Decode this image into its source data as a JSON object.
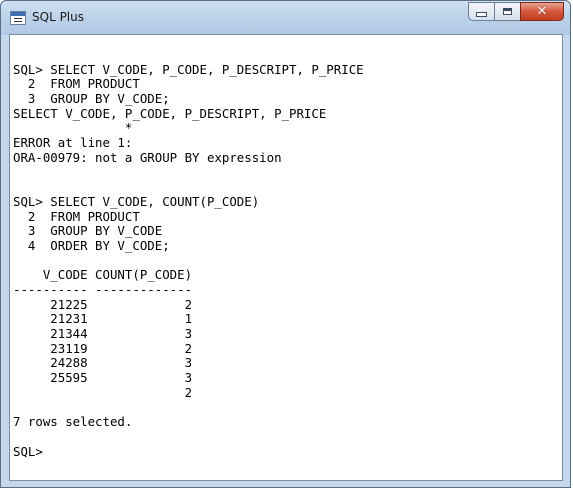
{
  "window": {
    "title": "SQL Plus"
  },
  "controls": {
    "minimize": "minimize",
    "maximize": "maximize",
    "close": "close"
  },
  "console": {
    "lines": [
      "",
      "SQL> SELECT V_CODE, P_CODE, P_DESCRIPT, P_PRICE",
      "  2  FROM PRODUCT",
      "  3  GROUP BY V_CODE;",
      "SELECT V_CODE, P_CODE, P_DESCRIPT, P_PRICE",
      "               *",
      "ERROR at line 1:",
      "ORA-00979: not a GROUP BY expression",
      "",
      "",
      "SQL> SELECT V_CODE, COUNT(P_CODE)",
      "  2  FROM PRODUCT",
      "  3  GROUP BY V_CODE",
      "  4  ORDER BY V_CODE;",
      "",
      "    V_CODE COUNT(P_CODE)",
      "---------- -------------",
      "     21225             2",
      "     21231             1",
      "     21344             3",
      "     23119             2",
      "     24288             3",
      "     25595             3",
      "                       2",
      "",
      "7 rows selected.",
      "",
      "SQL>"
    ]
  }
}
